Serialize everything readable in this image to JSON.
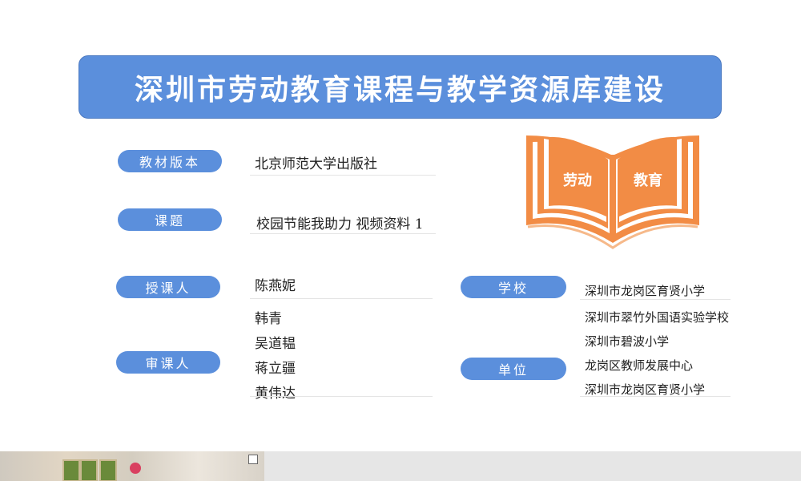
{
  "banner": {
    "title": "深圳市劳动教育课程与教学资源库建设"
  },
  "book": {
    "left_text": "劳动",
    "right_text": "教育",
    "color": "#f28c45"
  },
  "fields": {
    "textbook": {
      "label": "教材版本",
      "value": "北京师范大学出版社"
    },
    "topic": {
      "label": "课题",
      "value": "校园节能我助力  视频资料 1"
    },
    "teacher": {
      "label": "授课人",
      "value": "陈燕妮"
    },
    "reviewers": {
      "label": "审课人",
      "names": [
        "韩青",
        "吴道韫",
        "蒋立疆",
        "黄伟达"
      ]
    },
    "school": {
      "label": "学校",
      "value": "深圳市龙岗区育贤小学"
    },
    "units": {
      "label": "单位",
      "names": [
        "深圳市翠竹外国语实验学校",
        "深圳市碧波小学",
        "龙岗区教师发展中心",
        "深圳市龙岗区育贤小学"
      ]
    }
  },
  "colors": {
    "accent": "#5b8fdc",
    "book": "#f28c45"
  }
}
